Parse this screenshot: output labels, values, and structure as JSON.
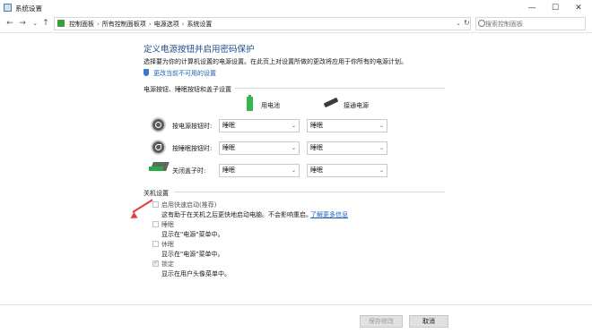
{
  "window": {
    "title": "系统设置",
    "controls": {
      "minimize": "—",
      "maximize": "☐",
      "close": "✕"
    }
  },
  "navigation": {
    "back": "←",
    "forward": "→",
    "recent": "⌄",
    "up": "↑",
    "breadcrumbs": [
      "控制面板",
      "所有控制面板项",
      "电源选项",
      "系统设置"
    ],
    "dropdown": "⌄",
    "refresh": "↻",
    "search_placeholder": "搜索控制面板"
  },
  "header": {
    "title": "定义电源按钮并启用密码保护",
    "description": "选择要为你的计算机设置的电源设置。在此页上对设置所做的更改将应用于你所有的电源计划。",
    "change_link": "更改当前不可用的设置"
  },
  "power_buttons": {
    "section_title": "电源按钮、睡眠按钮和盖子设置",
    "columns": {
      "battery": "用电池",
      "plugged": "接通电源"
    },
    "rows": [
      {
        "label": "按电源按钮时:",
        "battery": "睡眠",
        "plugged": "睡眠"
      },
      {
        "label": "按睡眠按钮时:",
        "battery": "睡眠",
        "plugged": "睡眠"
      },
      {
        "label": "关闭盖子时:",
        "battery": "睡眠",
        "plugged": "睡眠"
      }
    ],
    "chevron": "⌄"
  },
  "shutdown": {
    "section_title": "关机设置",
    "options": [
      {
        "label": "启用快速启动(推荐)",
        "desc": "这有助于在关机之后更快地启动电脑。不会影响重启。",
        "checked": false
      },
      {
        "label": "睡眠",
        "desc": "显示在\"电源\"菜单中。",
        "checked": false
      },
      {
        "label": "休眠",
        "desc": "显示在\"电源\"菜单中。",
        "checked": false
      },
      {
        "label": "锁定",
        "desc": "显示在用户头像菜单中。",
        "checked": true
      }
    ],
    "learn_more": "了解更多信息"
  },
  "footer": {
    "save_label": "保存修改",
    "cancel_label": "取消"
  },
  "colors": {
    "title_blue": "#1e4d8c",
    "link_blue": "#1d5fb8",
    "annotation_red": "#e03c3c",
    "battery_green": "#38b64a"
  },
  "icons": [
    "app-icon",
    "back-icon",
    "forward-icon",
    "up-icon",
    "control-panel-icon",
    "refresh-icon",
    "search-icon",
    "shield-icon",
    "battery-icon",
    "plug-icon",
    "power-button-icon",
    "sleep-button-icon",
    "laptop-lid-icon"
  ]
}
